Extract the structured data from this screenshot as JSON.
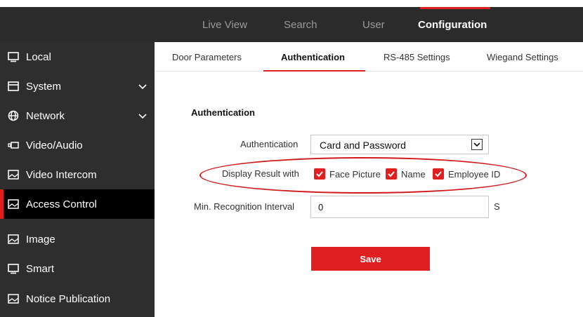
{
  "colors": {
    "accent": "#e02020",
    "header_bg": "#2b2b2b",
    "sidebar_bg": "#2e2e2e",
    "sidebar_active_bg": "#000000"
  },
  "topnav": {
    "live_view": "Live View",
    "search": "Search",
    "user": "User",
    "configuration": "Configuration"
  },
  "sidebar": {
    "items": [
      {
        "label": "Local",
        "icon": "monitor-icon"
      },
      {
        "label": "System",
        "icon": "window-icon"
      },
      {
        "label": "Network",
        "icon": "globe-icon"
      },
      {
        "label": "Video/Audio",
        "icon": "camera-icon"
      },
      {
        "label": "Video Intercom",
        "icon": "image-icon"
      },
      {
        "label": "Access Control",
        "icon": "image-icon"
      },
      {
        "label": "Image",
        "icon": "image-icon"
      },
      {
        "label": "Smart",
        "icon": "monitor-icon"
      },
      {
        "label": "Notice Publication",
        "icon": "image-icon"
      }
    ],
    "active": "Access Control"
  },
  "tabs": {
    "door_parameters": "Door Parameters",
    "authentication": "Authentication",
    "rs485": "RS-485 Settings",
    "wiegand": "Wiegand Settings"
  },
  "form": {
    "section_title": "Authentication",
    "authentication_label": "Authentication",
    "authentication_value": "Card and Password",
    "display_result_label": "Display Result with",
    "face_picture": "Face Picture",
    "name": "Name",
    "employee_id": "Employee ID",
    "min_interval_label": "Min. Recognition Interval",
    "min_interval_value": "0",
    "unit": "S",
    "save": "Save"
  }
}
